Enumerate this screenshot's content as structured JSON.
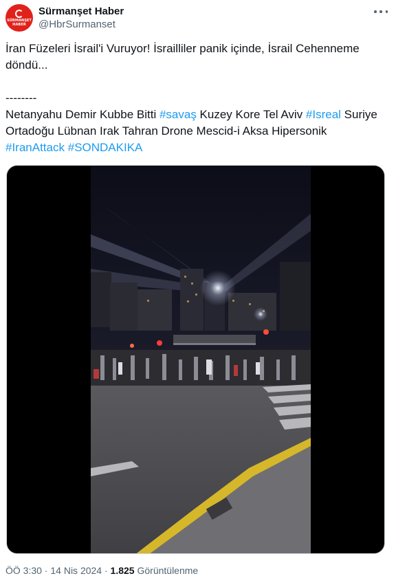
{
  "author": {
    "display_name": "Sürmanşet Haber",
    "handle": "@HbrSurmanset",
    "avatar_text_top": "SÜRMANŞET",
    "avatar_text_bottom": "HABER",
    "avatar_color": "#e0221b"
  },
  "tweet": {
    "line1": "İran Füzeleri İsrail'i Vuruyor! İsrailliler panik içinde, İsrail Cehenneme",
    "line2": "döndü...",
    "separator": "--------",
    "line4_a": "Netanyahu Demir Kubbe Bitti ",
    "tag1": "#savaş",
    "line4_b": " Kuzey Kore Tel Aviv ",
    "tag2": "#Isreal",
    "line4_c": " Suriye",
    "line5": "Ortadoğu Lübnan Irak Tahran Drone Mescid-i Aksa Hipersonik",
    "tag3": "#IranAttack",
    "line6_sep": " ",
    "tag4": "#SONDAKIKA"
  },
  "meta": {
    "time": "ÖÖ 3:30",
    "dot1": " · ",
    "date": "14 Nis 2024",
    "dot2": " · ",
    "views_count": "1.825",
    "views_label": " Görüntülenme"
  },
  "colors": {
    "link": "#1d9bf0",
    "text": "#0f1419",
    "secondary": "#536471"
  },
  "icons": {
    "more": "more-horizontal-icon",
    "video": "video-thumbnail"
  }
}
